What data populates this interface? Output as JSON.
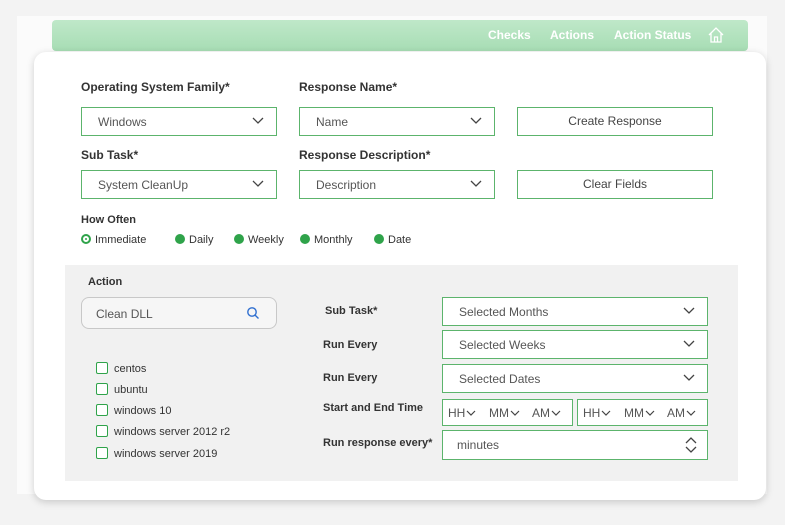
{
  "nav": {
    "links": [
      "Checks",
      "Actions",
      "Action Status"
    ],
    "home_icon": "home-icon"
  },
  "form": {
    "os_family": {
      "label": "Operating System Family*",
      "value": "Windows"
    },
    "response_name": {
      "label": "Response Name*",
      "value": "Name"
    },
    "create_button": "Create Response",
    "sub_task": {
      "label": "Sub Task*",
      "value": "System CleanUp"
    },
    "response_description": {
      "label": "Response Description*",
      "value": "Description"
    },
    "clear_button": "Clear Fields",
    "how_often": {
      "label": "How Often",
      "options": [
        "Immediate",
        "Daily",
        "Weekly",
        "Monthly",
        "Date"
      ],
      "selected": "Immediate"
    }
  },
  "action": {
    "label": "Action",
    "search_value": "Clean DLL",
    "os_list": [
      "centos",
      "ubuntu",
      "windows 10",
      "windows server 2012 r2",
      "windows server 2019"
    ],
    "sub_task": {
      "label": "Sub Task*",
      "value": "Selected Months"
    },
    "run_every_1": {
      "label": "Run Every",
      "value": "Selected Weeks"
    },
    "run_every_2": {
      "label": "Run Every",
      "value": "Selected Dates"
    },
    "time": {
      "label": "Start and End Time",
      "start": [
        "HH",
        "MM",
        "AM"
      ],
      "end": [
        "HH",
        "MM",
        "AM"
      ]
    },
    "run_response": {
      "label": "Run response every*",
      "value": "minutes"
    }
  },
  "colors": {
    "accent": "#2fa34a",
    "border": "#5cb46c",
    "nav": "#b3e2be"
  }
}
